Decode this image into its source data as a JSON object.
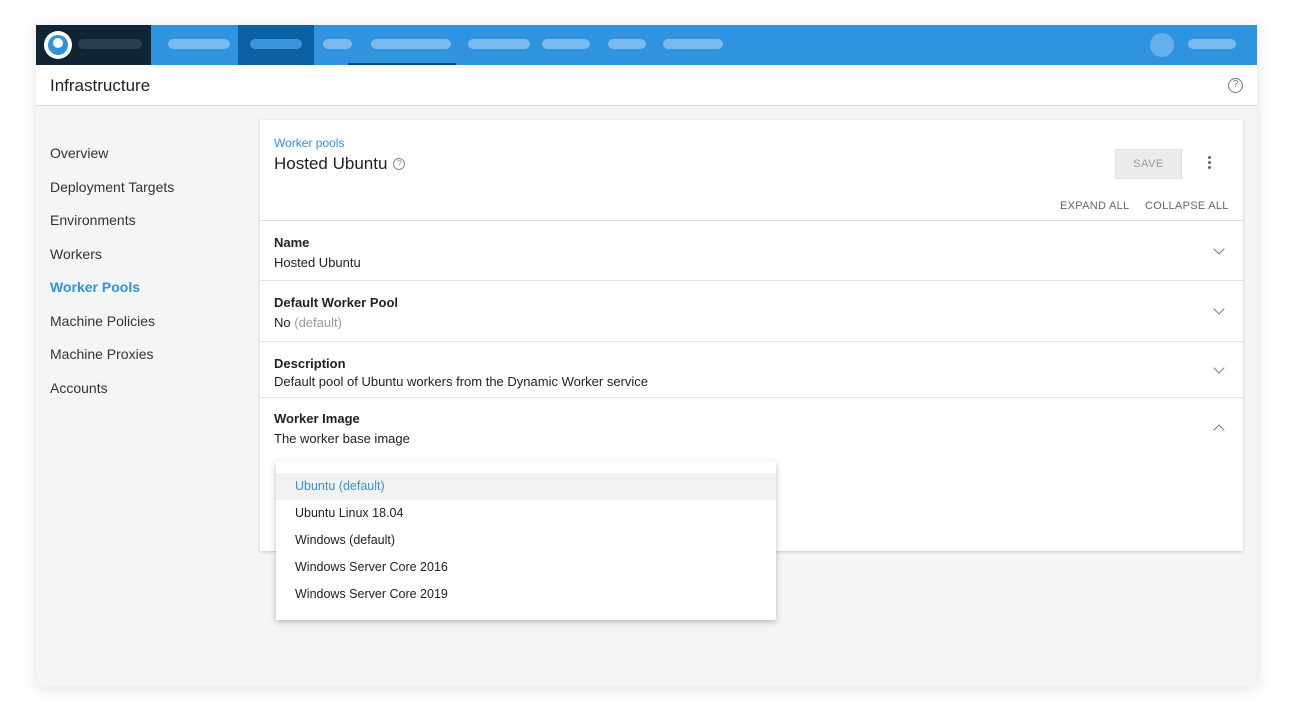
{
  "colors": {
    "topbar": "#2f93e0",
    "logo_bg": "#0f2535",
    "active_tab": "#0b5fa3",
    "accent": "#2f93e0"
  },
  "header": {
    "title": "Infrastructure",
    "help_icon": "question-circle-icon"
  },
  "sidebar": {
    "items": [
      {
        "label": "Overview",
        "active": false
      },
      {
        "label": "Deployment Targets",
        "active": false
      },
      {
        "label": "Environments",
        "active": false
      },
      {
        "label": "Workers",
        "active": false
      },
      {
        "label": "Worker Pools",
        "active": true
      },
      {
        "label": "Machine Policies",
        "active": false
      },
      {
        "label": "Machine Proxies",
        "active": false
      },
      {
        "label": "Accounts",
        "active": false
      }
    ]
  },
  "card": {
    "breadcrumb": "Worker pools",
    "title": "Hosted Ubuntu",
    "save_label": "SAVE",
    "expand_all": "EXPAND ALL",
    "collapse_all": "COLLAPSE ALL",
    "sections": {
      "name": {
        "title": "Name",
        "value": "Hosted Ubuntu"
      },
      "default_pool": {
        "title": "Default Worker Pool",
        "value": "No",
        "value_suffix": "(default)"
      },
      "description": {
        "title": "Description",
        "value": "Default pool of Ubuntu workers from the Dynamic Worker service"
      },
      "worker_image": {
        "title": "Worker Image",
        "value": "The worker base image"
      }
    }
  },
  "dropdown": {
    "options": [
      {
        "label": "Ubuntu (default)",
        "selected": true
      },
      {
        "label": "Ubuntu Linux 18.04",
        "selected": false
      },
      {
        "label": "Windows (default)",
        "selected": false
      },
      {
        "label": "Windows Server Core 2016",
        "selected": false
      },
      {
        "label": "Windows Server Core 2019",
        "selected": false
      }
    ]
  }
}
